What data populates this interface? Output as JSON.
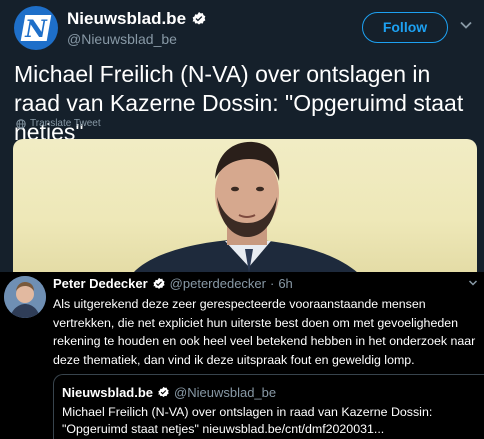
{
  "top_tweet": {
    "account_name": "Nieuwsblad.be",
    "handle": "@Nieuwsblad_be",
    "follow_label": "Follow",
    "headline": "Michael Freilich (N-VA) over ontslagen in raad van Kazerne Dossin: \"Opgeruimd staat netjes\"",
    "translate_label": "Translate Tweet",
    "avatar_letter": "N"
  },
  "reply_tweet": {
    "author_name": "Peter Dedecker",
    "handle": "@peterdedecker",
    "separator": "·",
    "time": "6h",
    "body": "Als uitgerekend deze zeer gerespecteerde vooraanstaande mensen vertrekken, die net expliciet hun uiterste best doen om met gevoeligheden rekening te houden en ook heel veel betekend hebben in het onderzoek naar deze thematiek, dan vind ik deze uitspraak fout en geweldig lomp.",
    "quoted": {
      "account_name": "Nieuwsblad.be",
      "handle": "@Nieuwsblad_be",
      "body": "Michael Freilich (N-VA) over ontslagen in raad van Kazerne Dossin: \"Opgeruimd staat netjes\" nieuwsblad.be/cnt/dmf2020031..."
    }
  },
  "colors": {
    "background": "#15202b",
    "accent": "#1da1f2",
    "muted_text": "#8899a6",
    "brand_blue": "#1e6fc9"
  },
  "icons": [
    "verified-badge-icon",
    "chevron-down-icon",
    "globe-icon",
    "caret-down-icon"
  ]
}
